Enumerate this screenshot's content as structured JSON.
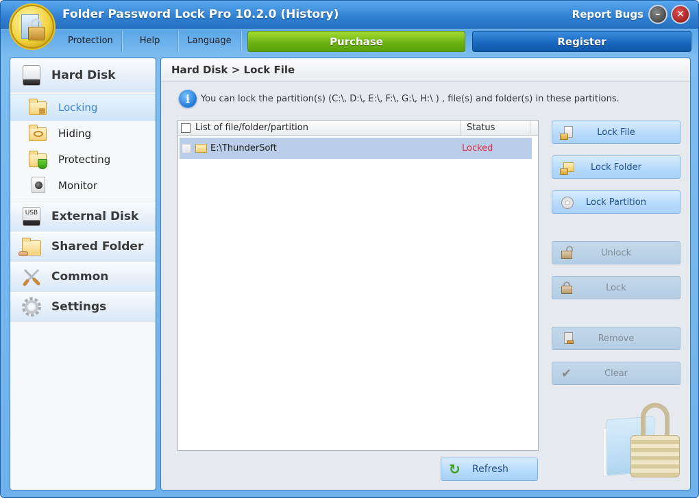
{
  "window": {
    "title": "Folder Password Lock Pro 10.2.0 (History)",
    "report_bugs": "Report Bugs",
    "minimize_glyph": "–",
    "close_glyph": "✕"
  },
  "menu": {
    "items": [
      {
        "label": "Protection"
      },
      {
        "label": "Help"
      },
      {
        "label": "Language"
      }
    ],
    "purchase_label": "Purchase",
    "register_label": "Register",
    "purchase_color": "#6fb414",
    "register_color": "#1a68c0"
  },
  "sidebar": {
    "categories": [
      {
        "label": "Hard Disk",
        "icon": "hard-disk-icon",
        "expanded": true,
        "items": [
          {
            "label": "Locking",
            "icon": "folder-lock-icon",
            "active": true
          },
          {
            "label": "Hiding",
            "icon": "folder-hide-icon",
            "active": false
          },
          {
            "label": "Protecting",
            "icon": "folder-shield-icon",
            "active": false
          },
          {
            "label": "Monitor",
            "icon": "monitor-camera-icon",
            "active": false
          }
        ]
      },
      {
        "label": "External Disk",
        "icon": "usb-drive-icon",
        "usb_text": "USB"
      },
      {
        "label": "Shared Folder",
        "icon": "shared-folder-icon"
      },
      {
        "label": "Common",
        "icon": "tools-icon"
      },
      {
        "label": "Settings",
        "icon": "gear-icon"
      }
    ]
  },
  "main": {
    "breadcrumb": "Hard Disk > Lock File",
    "info_icon_glyph": "i",
    "info_text": "You can lock the partition(s)  (C:\\, D:\\, E:\\, F:\\, G:\\, H:\\ ) , file(s) and folder(s) in these partitions.",
    "list": {
      "columns": [
        "List of file/folder/partition",
        "Status"
      ],
      "rows": [
        {
          "name": "E:\\ThunderSoft",
          "status": "Locked",
          "status_color": "#e0303e",
          "selected": true
        }
      ]
    },
    "actions": [
      {
        "label": "Lock File",
        "enabled": true
      },
      {
        "label": "Lock Folder",
        "enabled": true
      },
      {
        "label": "Lock Partition",
        "enabled": true
      },
      {
        "label": "Unlock",
        "enabled": false
      },
      {
        "label": "Lock",
        "enabled": false
      },
      {
        "label": "Remove",
        "enabled": false
      },
      {
        "label": "Clear",
        "enabled": false
      }
    ],
    "refresh_label": "Refresh",
    "refresh_glyph": "↻",
    "check_glyph": "✔"
  }
}
